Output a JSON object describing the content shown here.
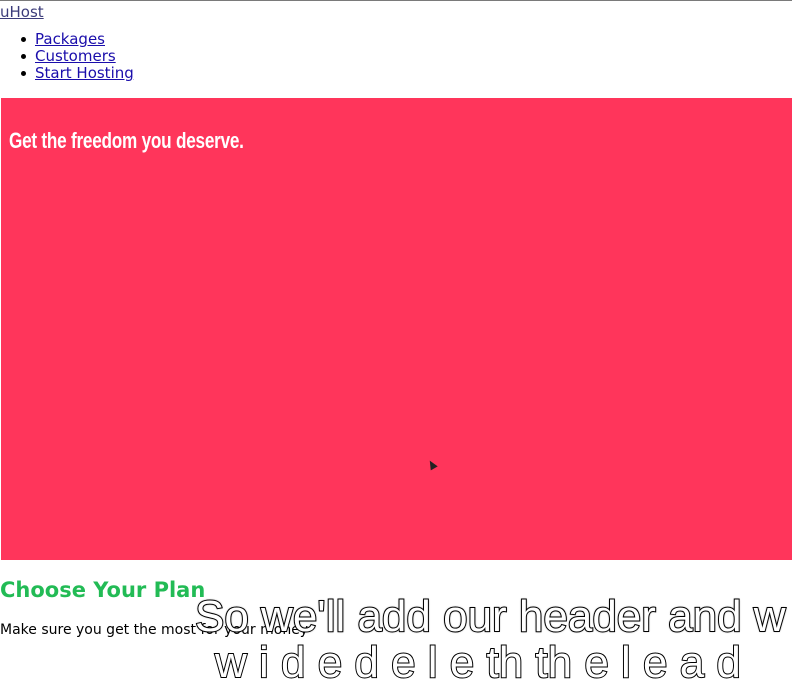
{
  "header": {
    "brand": "uHost",
    "nav": [
      {
        "label": "Packages"
      },
      {
        "label": "Customers"
      },
      {
        "label": "Start Hosting"
      }
    ]
  },
  "hero": {
    "title": "Get the freedom you deserve.",
    "background": "#ff355b"
  },
  "plans": {
    "title": "Choose Your Plan",
    "subtitle": "Make sure you get the most for your money",
    "title_color": "#22bb55"
  },
  "subtitle_overlay": {
    "line1": "So we'll add our header and w",
    "line2": "   w  i  d  e    d  e    l  e  th    th  e    l  e  a  d"
  }
}
